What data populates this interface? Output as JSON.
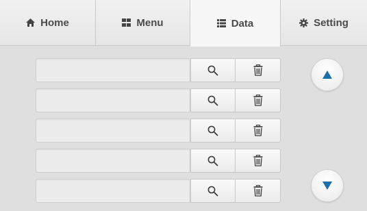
{
  "tabs": [
    {
      "label": "Home",
      "icon": "home-icon"
    },
    {
      "label": "Menu",
      "icon": "grid-icon"
    },
    {
      "label": "Data",
      "icon": "list-icon",
      "active": true
    },
    {
      "label": "Setting",
      "icon": "gear-icon"
    }
  ],
  "rows": [
    {
      "value": ""
    },
    {
      "value": ""
    },
    {
      "value": ""
    },
    {
      "value": ""
    },
    {
      "value": ""
    }
  ],
  "colors": {
    "accent": "#1c6fa8",
    "icon": "#3d3d3d",
    "background": "#dfdfdf"
  }
}
